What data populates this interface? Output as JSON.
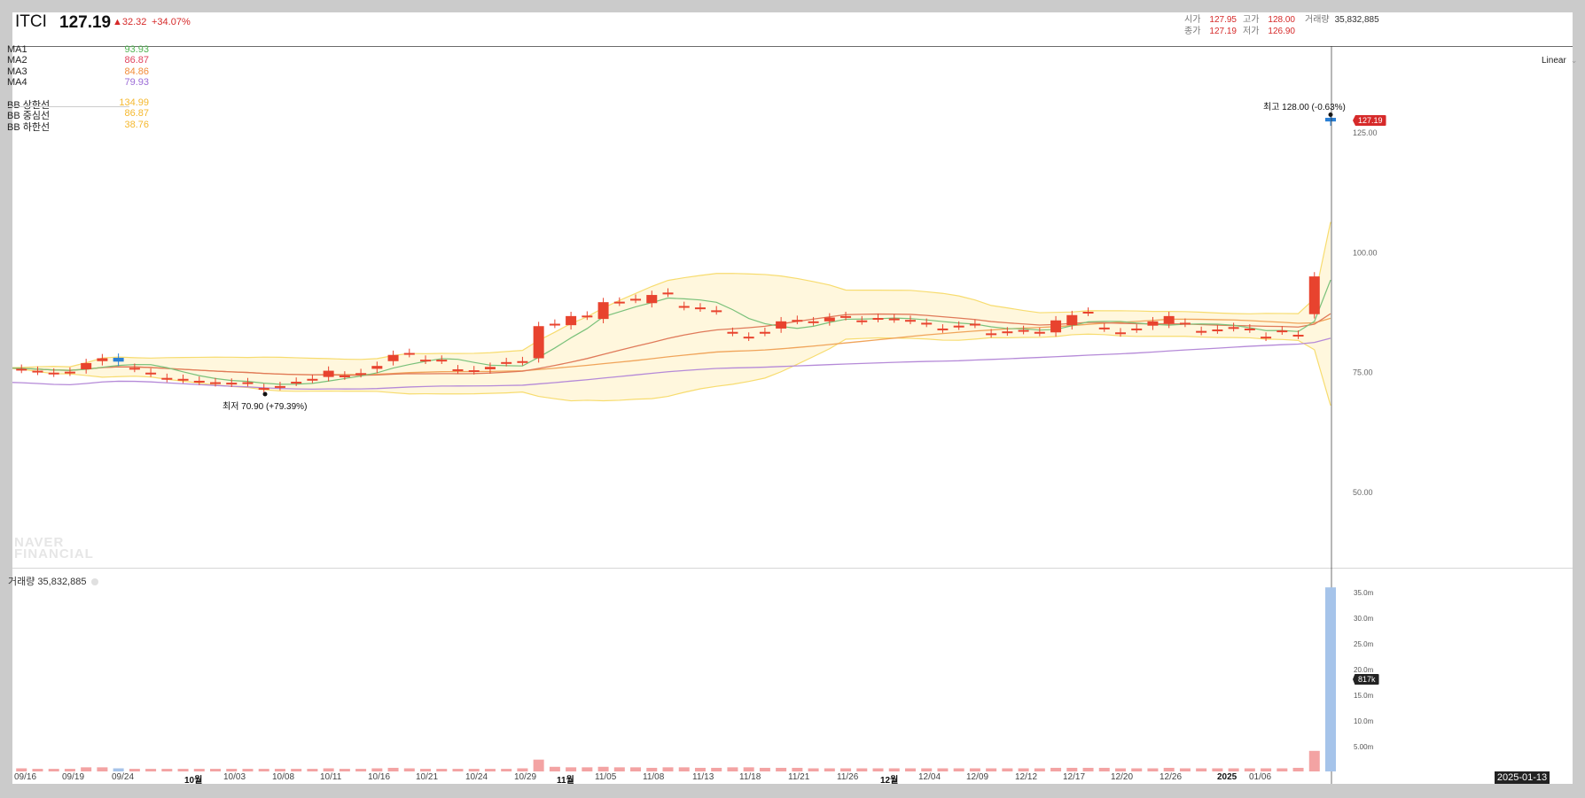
{
  "header": {
    "symbol": "ITCI",
    "price": "127.19",
    "change": "32.32",
    "change_pct": "+34.07%"
  },
  "ohlc": {
    "open_label": "시가",
    "open": "127.95",
    "high_label": "고가",
    "high": "128.00",
    "volume_label": "거래량",
    "volume": "35,832,885",
    "close_label": "종가",
    "close": "127.19",
    "low_label": "저가",
    "low": "126.90"
  },
  "legend": {
    "ma": [
      {
        "label": "MA1",
        "value": "93.93",
        "color": "#4fb34f"
      },
      {
        "label": "MA2",
        "value": "86.87",
        "color": "#e0435e"
      },
      {
        "label": "MA3",
        "value": "84.86",
        "color": "#f28c38"
      },
      {
        "label": "MA4",
        "value": "79.93",
        "color": "#9b6bd6"
      }
    ],
    "bb": [
      {
        "label": "BB 상한선",
        "value": "134.99",
        "color": "#f5b82e"
      },
      {
        "label": "BB 중심선",
        "value": "86.87",
        "color": "#f5b82e"
      },
      {
        "label": "BB 하한선",
        "value": "38.76",
        "color": "#f5b82e"
      }
    ]
  },
  "scale_mode": "Linear",
  "watermark": [
    "NAVER",
    "FINANCIAL"
  ],
  "annotations": {
    "high": "최고 128.00 (-0.63%)",
    "low": "최저 70.90 (+79.39%)"
  },
  "last_price_badge": "127.19",
  "last_volume_badge": "817k",
  "cursor_date": "2025-01-13",
  "volume_panel": {
    "label": "거래량 35,832,885"
  },
  "colors": {
    "up": "#e8432e",
    "down": "#2a7fd4",
    "bb_fill": "#fff7dd",
    "bb_line": "#f7dc6f"
  },
  "chart_data": {
    "type": "candlestick",
    "price_axis": {
      "ticks": [
        "125.00",
        "100.00",
        "75.00",
        "50.00"
      ],
      "tick_values": [
        125,
        100,
        75,
        50
      ]
    },
    "volume_axis": {
      "ticks": [
        "35.0m",
        "30.0m",
        "25.0m",
        "20.0m",
        "15.0m",
        "10.0m",
        "5.00m"
      ],
      "tick_values": [
        35,
        30,
        25,
        20,
        15,
        10,
        5
      ]
    },
    "x_ticks": [
      {
        "label": "09/16",
        "bold": false
      },
      {
        "label": "09/19",
        "bold": false
      },
      {
        "label": "09/24",
        "bold": false
      },
      {
        "label": "10월",
        "bold": true
      },
      {
        "label": "10/03",
        "bold": false
      },
      {
        "label": "10/08",
        "bold": false
      },
      {
        "label": "10/11",
        "bold": false
      },
      {
        "label": "10/16",
        "bold": false
      },
      {
        "label": "10/21",
        "bold": false
      },
      {
        "label": "10/24",
        "bold": false
      },
      {
        "label": "10/29",
        "bold": false
      },
      {
        "label": "11월",
        "bold": true
      },
      {
        "label": "11/05",
        "bold": false
      },
      {
        "label": "11/08",
        "bold": false
      },
      {
        "label": "11/13",
        "bold": false
      },
      {
        "label": "11/18",
        "bold": false
      },
      {
        "label": "11/21",
        "bold": false
      },
      {
        "label": "11/26",
        "bold": false
      },
      {
        "label": "12월",
        "bold": true
      },
      {
        "label": "12/04",
        "bold": false
      },
      {
        "label": "12/09",
        "bold": false
      },
      {
        "label": "12/12",
        "bold": false
      },
      {
        "label": "12/17",
        "bold": false
      },
      {
        "label": "12/20",
        "bold": false
      },
      {
        "label": "12/26",
        "bold": false
      },
      {
        "label": "2025",
        "bold": true
      },
      {
        "label": "01/06",
        "bold": false
      }
    ],
    "close": [
      75.8,
      75.6,
      75.2,
      74.8,
      75,
      76.8,
      77.8,
      77.1,
      75.8,
      74.8,
      73.7,
      73.5,
      73.1,
      72.8,
      72.7,
      72.8,
      71.6,
      72.0,
      72.9,
      73.5,
      75.2,
      74.2,
      74.7,
      76.2,
      78.5,
      78.9,
      77.5,
      77.5,
      75.5,
      75.3,
      76.0,
      77.0,
      77.2,
      84.5,
      85.0,
      86.6,
      86.7,
      89.5,
      89.6,
      90.2,
      91.0,
      91.5,
      88.7,
      88.4,
      87.8,
      83.3,
      82.3,
      83.3,
      85.5,
      85.8,
      85.5,
      86.3,
      86.6,
      85.7,
      86.2,
      86.1,
      85.8,
      85.2,
      84.0,
      84.6,
      85.0,
      83.0,
      83.4,
      83.7,
      83.3,
      85.7,
      86.8,
      87.5,
      84.2,
      83.2,
      84.0,
      85.5,
      86.6,
      85.2,
      83.5,
      83.8,
      84.3,
      84.0,
      82.3,
      83.6,
      82.7,
      94.87,
      127.19
    ],
    "open": [
      75.8,
      75.6,
      75.2,
      74.8,
      75,
      75.5,
      77.2,
      77.9,
      75.8,
      74.8,
      73.7,
      73.5,
      73.1,
      72.8,
      72.7,
      72.8,
      71.6,
      72.0,
      72.9,
      73.5,
      73.9,
      74.2,
      74.7,
      75.6,
      77.2,
      78.9,
      77.5,
      77.5,
      75.5,
      75.3,
      75.5,
      77.0,
      77.2,
      77.8,
      85.0,
      84.7,
      86.7,
      86.0,
      89.6,
      90.2,
      89.3,
      91.5,
      88.7,
      88.4,
      87.8,
      83.3,
      82.3,
      83.3,
      84.0,
      85.8,
      85.5,
      85.5,
      86.6,
      85.7,
      86.2,
      86.1,
      85.8,
      85.2,
      84.0,
      84.6,
      85.0,
      83.0,
      83.4,
      83.7,
      83.3,
      83.2,
      84.7,
      87.5,
      84.2,
      83.2,
      84.0,
      84.6,
      85.0,
      85.2,
      83.5,
      83.8,
      84.3,
      84.0,
      82.3,
      83.6,
      82.7,
      87.0,
      127.95
    ],
    "volume_millions": [
      0.6,
      0.6,
      0.5,
      0.5,
      0.5,
      0.8,
      0.8,
      0.6,
      0.5,
      0.5,
      0.5,
      0.5,
      0.5,
      0.5,
      0.5,
      0.5,
      0.5,
      0.5,
      0.5,
      0.5,
      0.6,
      0.5,
      0.5,
      0.6,
      0.7,
      0.6,
      0.5,
      0.5,
      0.5,
      0.5,
      0.5,
      0.5,
      0.6,
      2.3,
      0.9,
      0.8,
      0.8,
      0.9,
      0.8,
      0.8,
      0.7,
      0.8,
      0.8,
      0.7,
      0.7,
      0.8,
      0.8,
      0.7,
      0.7,
      0.7,
      0.6,
      0.6,
      0.6,
      0.6,
      0.6,
      0.6,
      0.6,
      0.6,
      0.6,
      0.6,
      0.6,
      0.6,
      0.6,
      0.6,
      0.6,
      0.7,
      0.7,
      0.7,
      0.7,
      0.6,
      0.6,
      0.6,
      0.7,
      0.6,
      0.6,
      0.6,
      0.6,
      0.6,
      0.6,
      0.6,
      0.7,
      4.0,
      35.83
    ]
  }
}
